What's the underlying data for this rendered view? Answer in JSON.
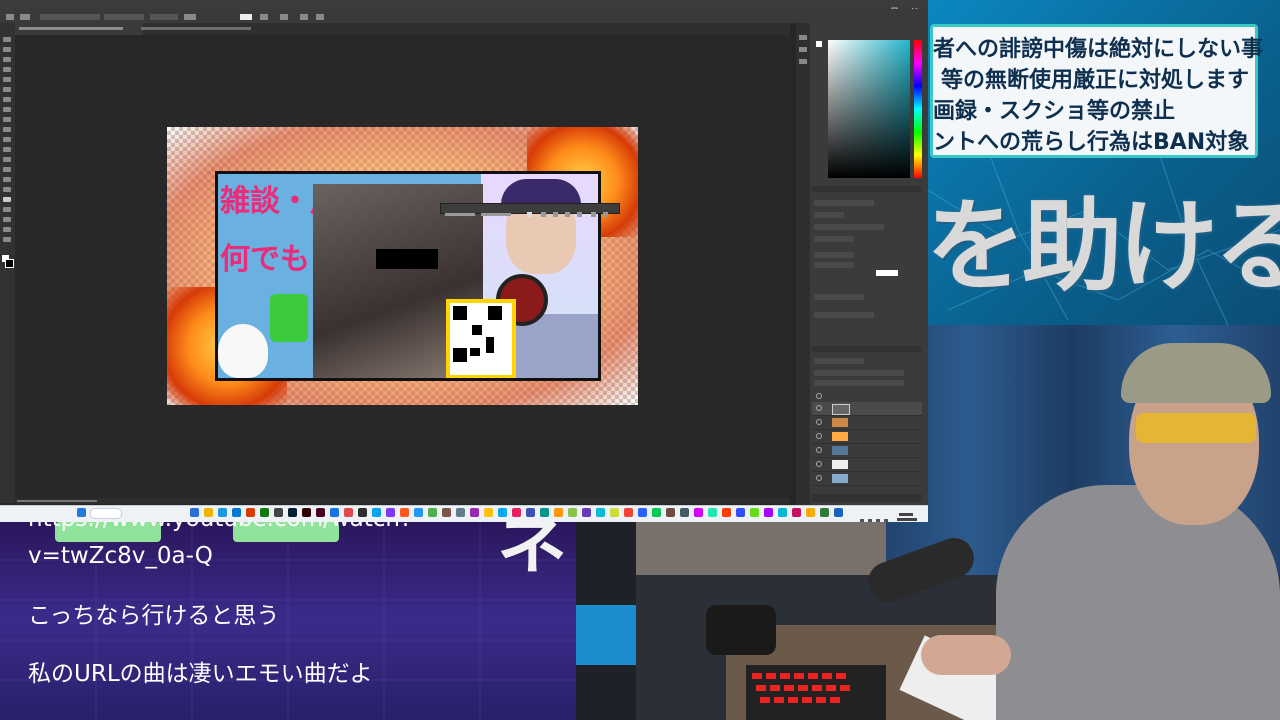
{
  "rules_banner": {
    "lines": [
      "者への誹謗中傷は絶対にしない事",
      "等の無断使用厳正に対処します",
      "画録・スクショ等の禁止",
      "ントへの荒らし行為はBAN対象"
    ],
    "headline": "を助ける"
  },
  "chat": {
    "lines": [
      "https://www.youtube.com/watch?",
      "v=twZc8v_0a-Q",
      "こっちなら行けると思う",
      "私のURLの曲は凄いエモい曲だよ"
    ]
  },
  "overlay_glyph": "ネ",
  "photoshop": {
    "flyer_text_top": "雑談・用事",
    "flyer_text_bottom": "何でも"
  },
  "colors": {
    "accent_teal": "#38c9c4",
    "banner_blue": "#0a6fa0",
    "chat_purple": "#3a1a6e",
    "flyer_pink": "#ea2d7a"
  }
}
